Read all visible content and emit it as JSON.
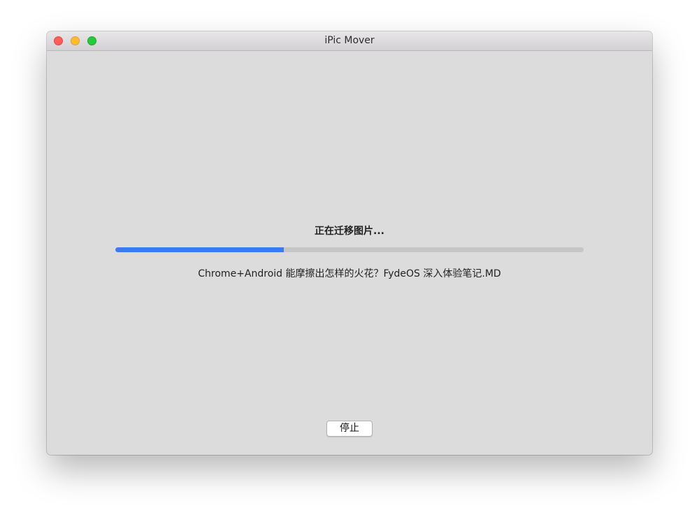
{
  "window": {
    "title": "iPic Mover"
  },
  "traffic_lights": [
    {
      "name": "close",
      "color": "#fc5f57"
    },
    {
      "name": "minimize",
      "color": "#fdbc2e"
    },
    {
      "name": "maximize",
      "color": "#2ac840"
    }
  ],
  "progress": {
    "status_text": "正在迁移图片...",
    "fraction": 0.36,
    "current_file": "Chrome+Android 能摩擦出怎样的火花？FydeOS 深入体验笔记.MD",
    "fill_color": "#3a7bf2"
  },
  "actions": {
    "stop_label": "停止"
  }
}
